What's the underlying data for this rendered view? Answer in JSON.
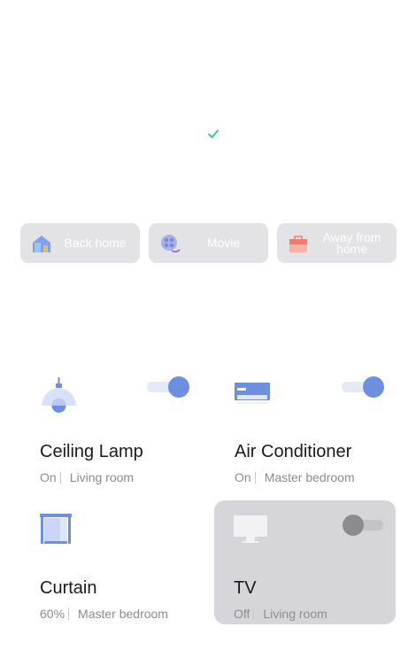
{
  "scenes": [
    {
      "label": "Back home",
      "icon": "house-icon"
    },
    {
      "label": "Movie",
      "icon": "film-reel-icon"
    },
    {
      "label": "Away from home",
      "icon": "suitcase-icon"
    }
  ],
  "devices": [
    {
      "name": "Ceiling Lamp",
      "state": "On",
      "room": "Living room",
      "icon": "ceiling-lamp-icon",
      "on": true
    },
    {
      "name": "Air Conditioner",
      "state": "On",
      "room": "Master bedroom",
      "icon": "air-conditioner-icon",
      "on": true
    },
    {
      "name": "Curtain",
      "state": "60%",
      "room": "Master bedroom",
      "icon": "curtain-icon"
    },
    {
      "name": "TV",
      "state": "Off",
      "room": "Living room",
      "icon": "tv-icon",
      "on": false
    }
  ],
  "colors": {
    "accent": "#6d8fe0",
    "check": "#3fc79a",
    "scene_bg": "#e3e3e5",
    "card_off": "#d6d6da"
  }
}
